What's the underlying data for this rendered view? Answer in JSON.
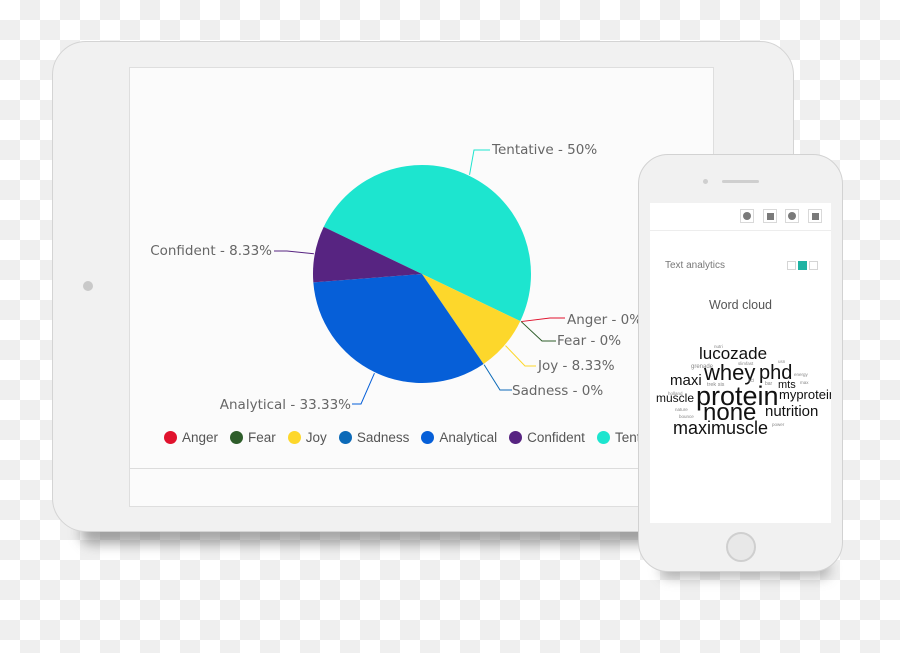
{
  "tablet": {
    "chart_data": {
      "type": "pie",
      "title": "",
      "slices": [
        {
          "label": "Tentative",
          "value": 50,
          "color": "#1de5cf",
          "data_label": "Tentative - 50%"
        },
        {
          "label": "Anger",
          "value": 0,
          "color": "#e0122d",
          "data_label": "Anger - 0%"
        },
        {
          "label": "Fear",
          "value": 0,
          "color": "#2e5d2a",
          "data_label": "Fear - 0%"
        },
        {
          "label": "Joy",
          "value": 8.33,
          "color": "#fdd72b",
          "data_label": "Joy - 8.33%"
        },
        {
          "label": "Sadness",
          "value": 0,
          "color": "#0c6ab8",
          "data_label": "Sadness - 0%"
        },
        {
          "label": "Analytical",
          "value": 33.33,
          "color": "#065fd8",
          "data_label": "Analytical - 33.33%"
        },
        {
          "label": "Confident",
          "value": 8.33,
          "color": "#572481",
          "data_label": "Confident - 8.33%"
        }
      ],
      "legend": {
        "placement": "bottom",
        "entries": [
          {
            "label": "Anger",
            "color": "#e0122d"
          },
          {
            "label": "Fear",
            "color": "#2e5d2a"
          },
          {
            "label": "Joy",
            "color": "#fdd72b"
          },
          {
            "label": "Sadness",
            "color": "#0c6ab8"
          },
          {
            "label": "Analytical",
            "color": "#065fd8"
          },
          {
            "label": "Confident",
            "color": "#572481"
          },
          {
            "label": "Tentative",
            "color": "#1de5cf"
          }
        ]
      }
    }
  },
  "phone": {
    "toolbar_icons": [
      "circle-icon",
      "square-icon",
      "circle-icon",
      "square-icon"
    ],
    "section_label": "Text analytics",
    "pager": {
      "count": 3,
      "active_index": 1,
      "active_color": "#1fb3a3"
    },
    "wordcloud_title": "Word cloud",
    "wordcloud_words": [
      {
        "text": "lucozade",
        "weight": 3
      },
      {
        "text": "whey",
        "weight": 4
      },
      {
        "text": "phd",
        "weight": 4
      },
      {
        "text": "maxi",
        "weight": 3
      },
      {
        "text": "protein",
        "weight": 5
      },
      {
        "text": "muscle",
        "weight": 2
      },
      {
        "text": "myprotein",
        "weight": 2
      },
      {
        "text": "none",
        "weight": 5
      },
      {
        "text": "nutrition",
        "weight": 3
      },
      {
        "text": "maximuscle",
        "weight": 4
      },
      {
        "text": "mts",
        "weight": 2
      },
      {
        "text": "grenade",
        "weight": 1
      },
      {
        "text": "trek sis",
        "weight": 1
      },
      {
        "text": "sci",
        "weight": 1
      },
      {
        "text": "bar",
        "weight": 1
      },
      {
        "text": "holland",
        "weight": 1
      },
      {
        "text": "nature",
        "weight": 1
      },
      {
        "text": "bounce",
        "weight": 1
      },
      {
        "text": "slimfast",
        "weight": 1
      },
      {
        "text": "energy",
        "weight": 1
      },
      {
        "text": "usn",
        "weight": 1
      },
      {
        "text": "nutri",
        "weight": 1
      },
      {
        "text": "power",
        "weight": 1
      },
      {
        "text": "max",
        "weight": 1
      }
    ]
  }
}
